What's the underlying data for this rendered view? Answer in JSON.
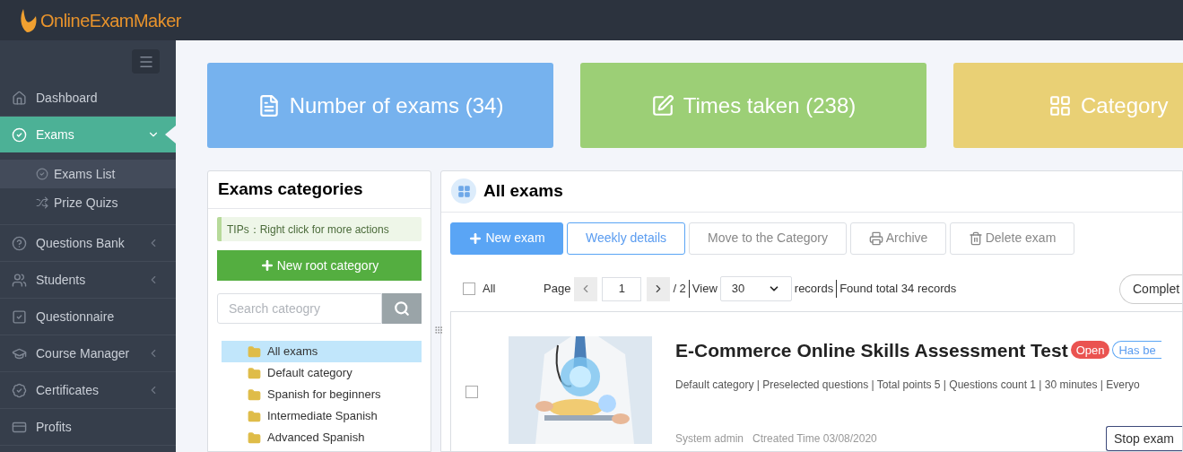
{
  "header": {
    "logo_text": "OnlineExamMaker"
  },
  "sidebar": {
    "items": [
      {
        "label": "Dashboard",
        "selected": false
      },
      {
        "label": "Exams",
        "selected": true,
        "expanded": true,
        "children": [
          {
            "label": "Exams List",
            "selected": true
          },
          {
            "label": "Prize Quizs",
            "selected": false
          }
        ]
      },
      {
        "label": "Questions Bank",
        "selected": false,
        "expanded": false
      },
      {
        "label": "Students",
        "selected": false,
        "expanded": false
      },
      {
        "label": "Questionnaire",
        "selected": false
      },
      {
        "label": "Course Manager",
        "selected": false,
        "expanded": false
      },
      {
        "label": "Certificates",
        "selected": false,
        "expanded": false
      },
      {
        "label": "Profits",
        "selected": false
      }
    ]
  },
  "stats": [
    {
      "label": "Number of exams (34)",
      "color": "#76b2ee"
    },
    {
      "label": "Times taken (238)",
      "color": "#9ccf76"
    },
    {
      "label": "Category",
      "color": "#e9d075"
    }
  ],
  "categories": {
    "title": "Exams categories",
    "tip": "TIPs：Right click for more actions",
    "new_button": "New root category",
    "search": {
      "placeholder": "Search cateogry"
    },
    "items": [
      {
        "label": "All exams",
        "selected": true
      },
      {
        "label": "Default category",
        "selected": false
      },
      {
        "label": "Spanish for beginners",
        "selected": false
      },
      {
        "label": "Intermediate Spanish",
        "selected": false
      },
      {
        "label": "Advanced Spanish",
        "selected": false
      }
    ]
  },
  "exams": {
    "title": "All exams",
    "toolbar": [
      {
        "label": "New exam",
        "kind": "primary"
      },
      {
        "label": "Weekly details",
        "kind": "outline"
      },
      {
        "label": "Move to the Category",
        "kind": "default"
      },
      {
        "label": "Archive",
        "kind": "default"
      },
      {
        "label": "Delete exam",
        "kind": "default"
      }
    ],
    "pager": {
      "select_all": {
        "label": "All",
        "checked": false
      },
      "page_label": "Page",
      "page": "1",
      "total_pages": "/ 2",
      "view_label": "View",
      "view": "30",
      "records_label": "records",
      "found": "Found total 34 records",
      "filter": "Complet"
    },
    "list": [
      {
        "title": "E-Commerce Online Skills Assessment Test",
        "checked": false,
        "tags": [
          {
            "label": "Open",
            "kind": "filled"
          },
          {
            "label": "Has be",
            "kind": "outline"
          }
        ],
        "meta": "Default category | Preselected questions | Total points 5 | Questions count 1 | 30 minutes | Everyo",
        "author": "System admin",
        "created": "Ctreated Time 03/08/2020",
        "action": "Stop exam"
      }
    ]
  }
}
